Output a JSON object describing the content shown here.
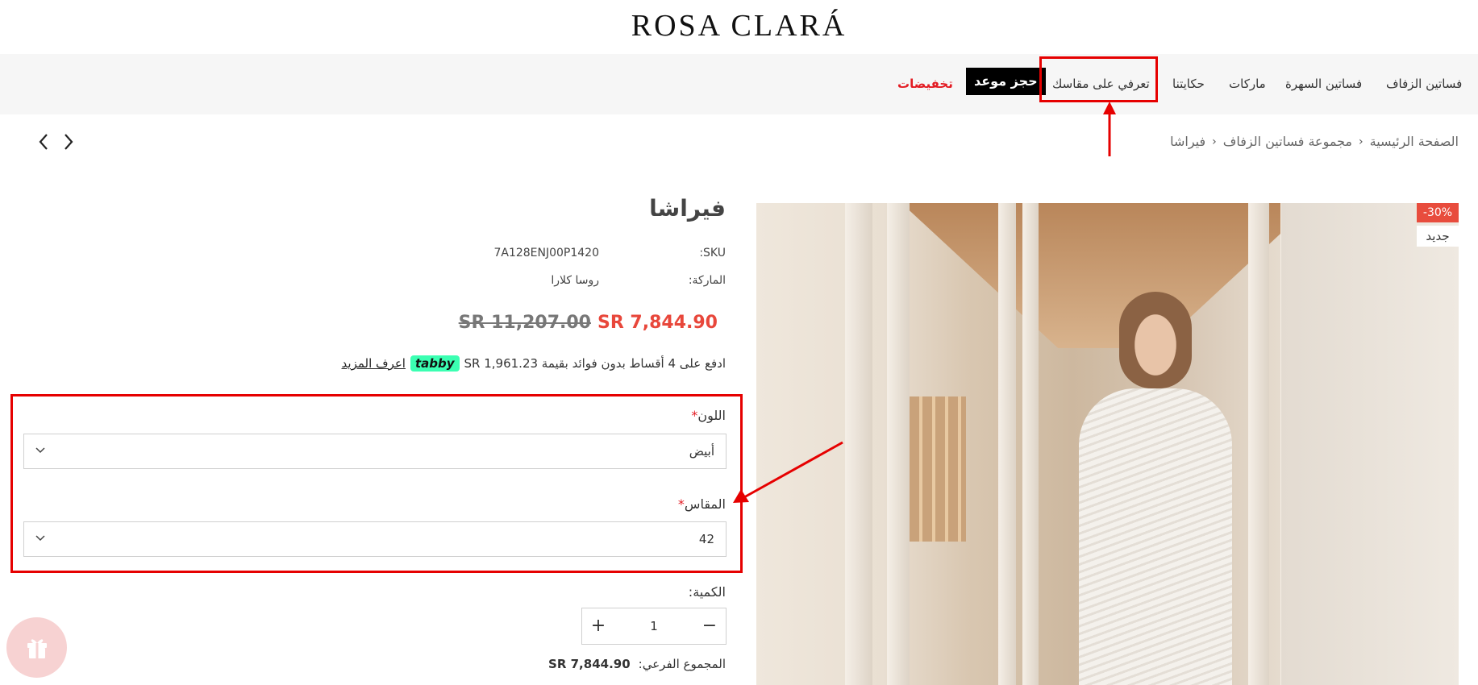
{
  "brand": {
    "logo_text": "ROSA CLARÁ"
  },
  "nav": {
    "items": [
      "فساتين الزفاف",
      "فساتين السهرة",
      "ماركات",
      "حكايتنا",
      "تعرفي على مقاسك"
    ],
    "appointment_label": "حجز موعد",
    "sale_label": "تخفيضات"
  },
  "breadcrumb": [
    "الصفحة الرئيسية",
    "مجموعة فساتين الزفاف",
    "فيراشا"
  ],
  "product": {
    "badge_discount": "-30%",
    "badge_new": "جديد",
    "title": "فيراشا",
    "sku_label": "SKU:",
    "sku_value": "7A128ENJ00P1420",
    "brand_label": "الماركة:",
    "brand_value": "روسا كلارا",
    "price_new": "SR 7,844.90",
    "price_old": "SR 11,207.00",
    "tabby_text": "ادفع على 4 أقساط بدون فوائد بقيمة SR 1,961.23",
    "tabby_brand": "tabby",
    "tabby_link": "اعرف المزيد",
    "color_label": "اللون",
    "color_value": "أبيض",
    "size_label": "المقاس",
    "size_value": "42",
    "required_mark": "*",
    "qty_label": "الكمية:",
    "qty_value": "1",
    "subtotal_label": "المجموع الفرعي:",
    "subtotal_value": "SR 7,844.90"
  },
  "colors": {
    "accent_red": "#e31b23",
    "tabby_green": "#3bffb2",
    "annotation_red": "#e60000"
  },
  "icons": [
    "chevron-left-icon",
    "chevron-right-icon",
    "chevron-down-icon",
    "plus-icon",
    "minus-icon",
    "gift-icon"
  ]
}
